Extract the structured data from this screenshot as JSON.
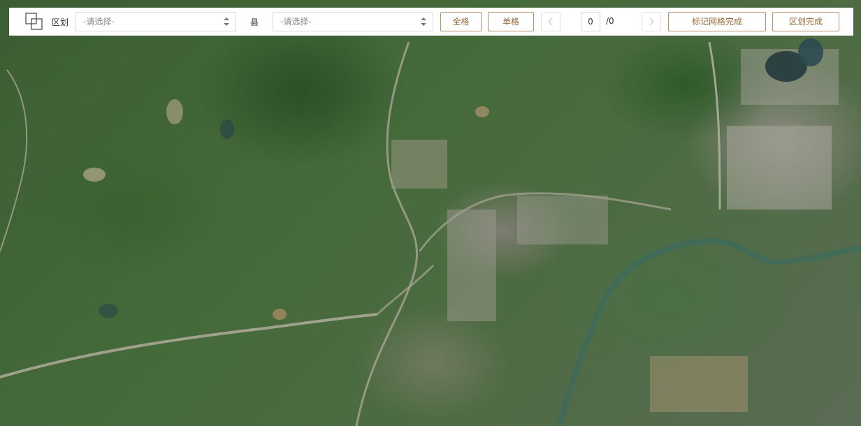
{
  "toolbar": {
    "district_label": "区划",
    "district_placeholder": "-请选择-",
    "county_label": "县",
    "county_placeholder": "-请选择-",
    "full_grid_button": "全格",
    "single_grid_button": "单格",
    "prev_icon": "chevron-left-icon",
    "next_icon": "chevron-right-icon",
    "page_current": "0",
    "page_total": "/0",
    "mark_grid_done_button": "标记网格完成",
    "district_done_button": "区划完成",
    "accent_color": "#b8906a"
  },
  "map": {
    "type": "satellite-imagery"
  }
}
